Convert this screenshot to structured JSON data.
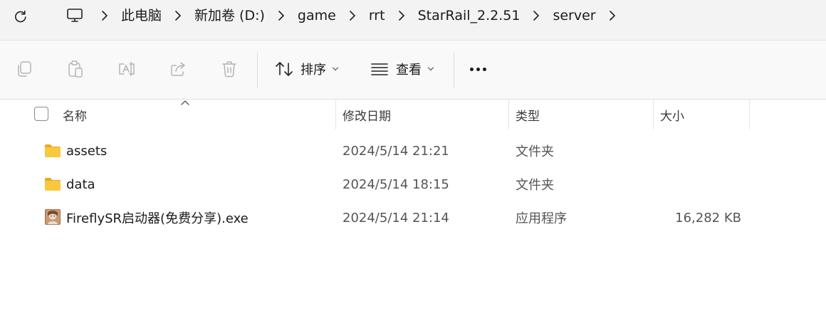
{
  "breadcrumb": {
    "items": [
      "此电脑",
      "新加卷 (D:)",
      "game",
      "rrt",
      "StarRail_2.2.51",
      "server"
    ],
    "root_icon": "computer-icon"
  },
  "toolbar": {
    "icons": [
      "copy-icon",
      "paste-icon",
      "rename-icon",
      "share-icon",
      "delete-icon"
    ],
    "sort_label": "排序",
    "view_label": "查看",
    "more_icon": "more-icon"
  },
  "columns": {
    "name": "名称",
    "modified": "修改日期",
    "type": "类型",
    "size": "大小"
  },
  "files": [
    {
      "name": "assets",
      "modified": "2024/5/14 21:21",
      "type": "文件夹",
      "size": "",
      "icon": "folder-icon"
    },
    {
      "name": "data",
      "modified": "2024/5/14 18:15",
      "type": "文件夹",
      "size": "",
      "icon": "folder-icon"
    },
    {
      "name": "FireflySR启动器(免费分享).exe",
      "modified": "2024/5/14 21:14",
      "type": "应用程序",
      "size": "16,282 KB",
      "icon": "app-icon"
    }
  ],
  "colors": {
    "folder": "#f8c93c",
    "address_bg": "#f3f3f3",
    "toolbar_bg": "#f9f9f9",
    "disabled_icon": "#b4b4b4"
  }
}
